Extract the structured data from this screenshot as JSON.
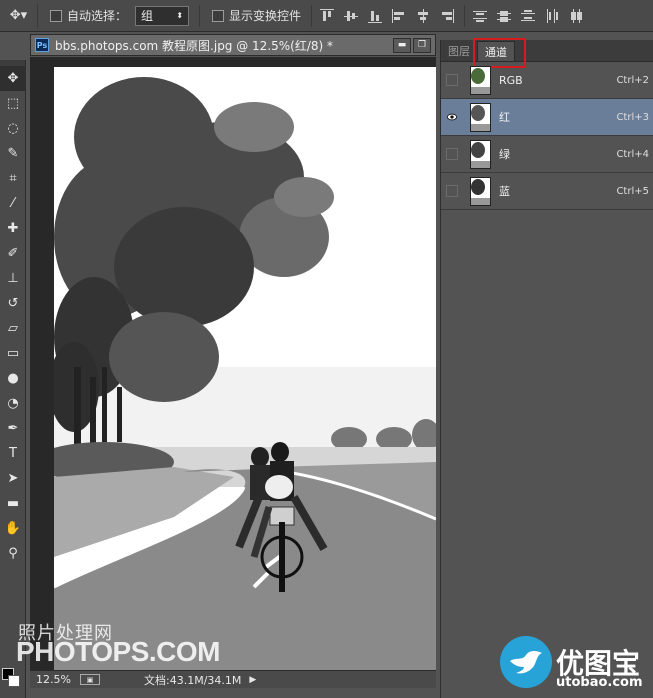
{
  "options_bar": {
    "tool_preset_icon": "move-tool-icon",
    "auto_select_label": "自动选择：",
    "auto_select_value": "组",
    "show_transform_label": "显示变换控件"
  },
  "toolbox": {
    "tools": [
      "move-tool-icon",
      "marquee-tool-icon",
      "lasso-tool-icon",
      "quick-select-tool-icon",
      "crop-tool-icon",
      "eyedropper-tool-icon",
      "healing-brush-tool-icon",
      "brush-tool-icon",
      "clone-stamp-tool-icon",
      "history-brush-tool-icon",
      "eraser-tool-icon",
      "gradient-tool-icon",
      "blur-tool-icon",
      "dodge-tool-icon",
      "pen-tool-icon",
      "type-tool-icon",
      "path-select-tool-icon",
      "shape-tool-icon",
      "hand-tool-icon",
      "zoom-tool-icon"
    ],
    "foreground_color": "#000000",
    "background_color": "#ffffff"
  },
  "document": {
    "badge": "Ps",
    "title": "bbs.photops.com 教程原图.jpg @ 12.5%(红/8) *",
    "minimize": "▬",
    "restore": "❐"
  },
  "status": {
    "zoom": "12.5%",
    "doc_size": "文档:43.1M/34.1M"
  },
  "panel": {
    "tabs": [
      {
        "label": "图层"
      },
      {
        "label": "通道"
      }
    ],
    "channels": [
      {
        "name": "RGB",
        "shortcut": "Ctrl+2",
        "visible": false,
        "selected": false
      },
      {
        "name": "红",
        "shortcut": "Ctrl+3",
        "visible": true,
        "selected": true
      },
      {
        "name": "绿",
        "shortcut": "Ctrl+4",
        "visible": false,
        "selected": false
      },
      {
        "name": "蓝",
        "shortcut": "Ctrl+5",
        "visible": false,
        "selected": false
      }
    ],
    "highlight_color": "#d61d1d"
  },
  "watermarks": {
    "left_cn": "照片处理网",
    "left_en": "PHOTOPS.COM",
    "right_cn": "优图宝",
    "right_url": "utobao.com"
  }
}
